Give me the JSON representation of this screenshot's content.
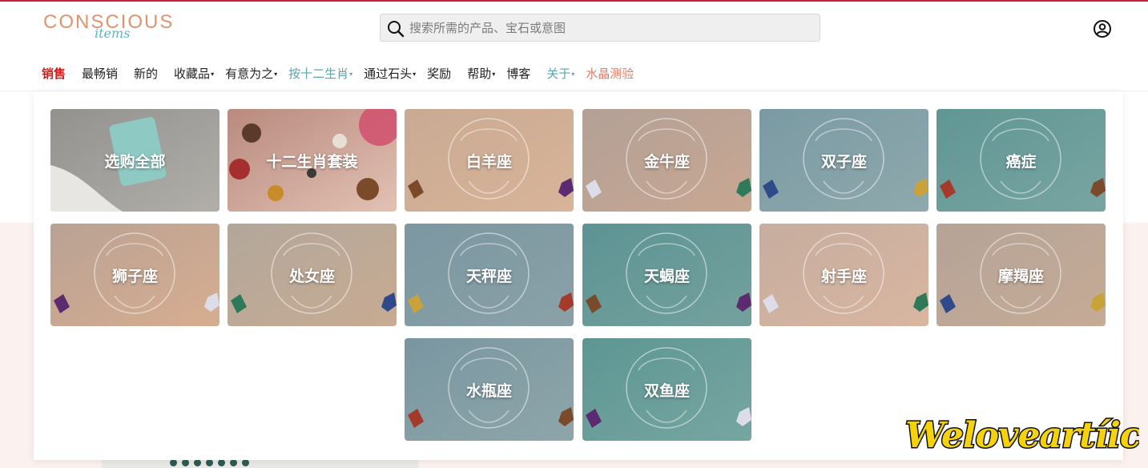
{
  "brand": {
    "logo_main": "CONSCIOUS",
    "logo_sub": "items"
  },
  "search": {
    "placeholder": "搜索所需的产品、宝石或意图"
  },
  "nav": [
    {
      "label": "销售",
      "style": "sale",
      "caret": false
    },
    {
      "label": "最畅销",
      "style": "",
      "caret": false
    },
    {
      "label": "新的",
      "style": "",
      "caret": false
    },
    {
      "label": "收藏品",
      "style": "",
      "caret": true
    },
    {
      "label": "有意为之",
      "style": "",
      "caret": true
    },
    {
      "label": "按十二生肖",
      "style": "teal",
      "caret": true
    },
    {
      "label": "通过石头",
      "style": "",
      "caret": true
    },
    {
      "label": "奖励",
      "style": "",
      "caret": false
    },
    {
      "label": "帮助",
      "style": "",
      "caret": true
    },
    {
      "label": "博客",
      "style": "",
      "caret": false
    },
    {
      "label": "关于",
      "style": "teal",
      "caret": true
    },
    {
      "label": "水晶测验",
      "style": "coral",
      "caret": false
    }
  ],
  "zodiac_menu": [
    {
      "label": "选购全部",
      "icon": "crystal-box-photo",
      "bg1": "#8c8c89",
      "bg2": "#c8c5c0"
    },
    {
      "label": "十二生肖套装",
      "icon": "crystal-grid-photo",
      "bg1": "#b98a7e",
      "bg2": "#e2c1b4"
    },
    {
      "label": "白羊座",
      "icon": "aries-icon",
      "bg1": "#c9aa92",
      "bg2": "#d8b499"
    },
    {
      "label": "金牛座",
      "icon": "taurus-icon",
      "bg1": "#b3a096",
      "bg2": "#c8a792"
    },
    {
      "label": "双子座",
      "icon": "gemini-icon",
      "bg1": "#7a9aa3",
      "bg2": "#8fa9ad"
    },
    {
      "label": "癌症",
      "icon": "cancer-icon",
      "bg1": "#5f9694",
      "bg2": "#79a5a2"
    },
    {
      "label": "狮子座",
      "icon": "leo-icon",
      "bg1": "#b9a294",
      "bg2": "#d7ad90"
    },
    {
      "label": "处女座",
      "icon": "virgo-icon",
      "bg1": "#b2a79b",
      "bg2": "#c8ab92"
    },
    {
      "label": "天秤座",
      "icon": "libra-icon",
      "bg1": "#7b97a1",
      "bg2": "#8aa1a7"
    },
    {
      "label": "天蝎座",
      "icon": "scorpio-icon",
      "bg1": "#5c9493",
      "bg2": "#74a19e"
    },
    {
      "label": "射手座",
      "icon": "sagittarius-icon",
      "bg1": "#c6ad9f",
      "bg2": "#d9b6a0"
    },
    {
      "label": "摩羯座",
      "icon": "capricorn-icon",
      "bg1": "#b5a397",
      "bg2": "#c6ab96"
    },
    {
      "label": "水瓶座",
      "icon": "aquarius-icon",
      "bg1": "#7996a0",
      "bg2": "#8ea6aa"
    },
    {
      "label": "双鱼座",
      "icon": "pisces-icon",
      "bg1": "#5d9693",
      "bg2": "#77a6a1"
    }
  ],
  "watermark": "Weloveartíicle",
  "colors": {
    "sale": "#cc1f1f",
    "teal": "#5aa6ae",
    "coral": "#d8816a",
    "top_border": "#c62332"
  }
}
